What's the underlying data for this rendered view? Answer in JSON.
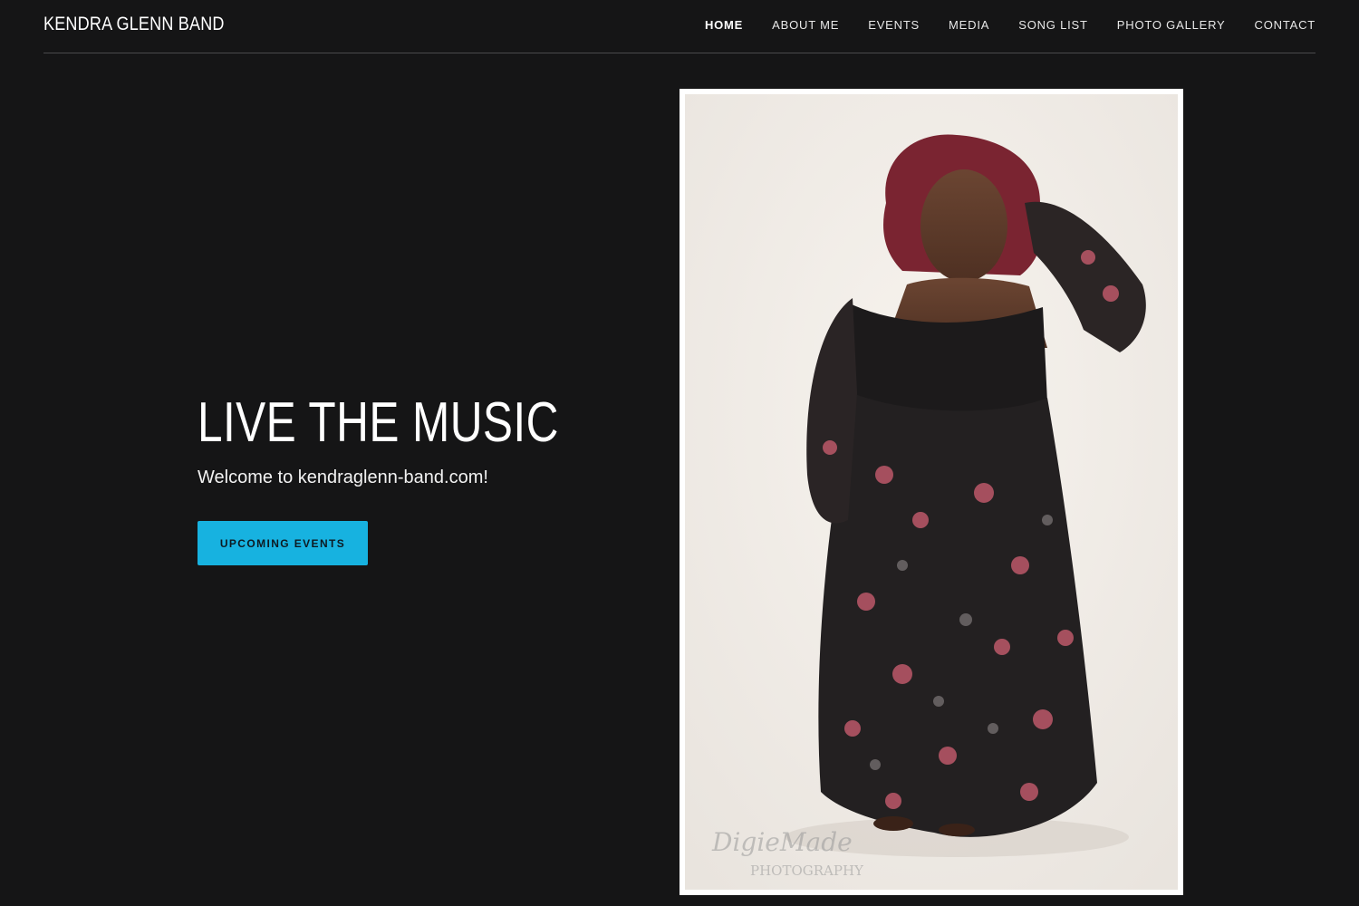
{
  "site": {
    "title": "KENDRA GLENN BAND"
  },
  "nav": {
    "items": [
      {
        "label": "HOME",
        "active": true
      },
      {
        "label": "ABOUT ME",
        "active": false
      },
      {
        "label": "EVENTS",
        "active": false
      },
      {
        "label": "MEDIA",
        "active": false
      },
      {
        "label": "SONG LIST",
        "active": false
      },
      {
        "label": "PHOTO GALLERY",
        "active": false
      },
      {
        "label": "CONTACT",
        "active": false
      }
    ]
  },
  "hero": {
    "title": "LIVE THE MUSIC",
    "subtitle": "Welcome to kendraglenn-band.com!",
    "cta_label": "UPCOMING EVENTS"
  },
  "photo": {
    "watermark_line1": "DigieMade",
    "watermark_line2": "PHOTOGRAPHY"
  },
  "colors": {
    "background": "#151516",
    "accent": "#17b2e0"
  }
}
